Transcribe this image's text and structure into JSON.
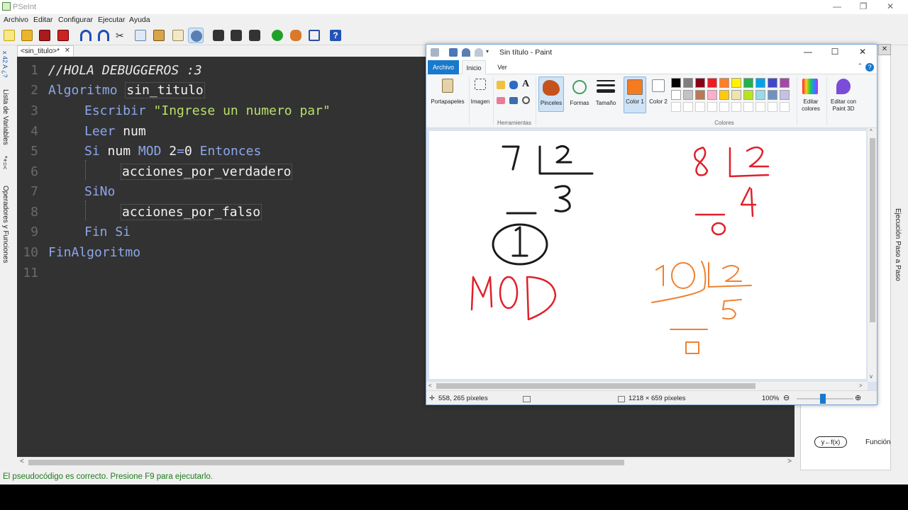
{
  "pseint": {
    "window_title": "PSeInt",
    "menu": [
      "Archivo",
      "Editar",
      "Configurar",
      "Ejecutar",
      "Ayuda"
    ],
    "left_panel_labels": [
      "Lista de Variables",
      "Operadores y Funciones"
    ],
    "editor_tab": "<sin_titulo>*",
    "tab_close": "✕",
    "code_lines": [
      {
        "n": "1",
        "text": "//HOLA DEBUGGEROS :3"
      },
      {
        "n": "2",
        "kw1": "Algoritmo",
        "id": "sin_titulo"
      },
      {
        "n": "3",
        "kw1": "Escribir",
        "str": "\"Ingrese un numero par\""
      },
      {
        "n": "4",
        "kw1": "Leer",
        "id": "num"
      },
      {
        "n": "5",
        "kw1": "Si",
        "id": "num",
        "kw2": "MOD",
        "num": "2",
        "op": "=",
        "num2": "0",
        "kw3": "Entonces"
      },
      {
        "n": "6",
        "id": "acciones_por_verdadero"
      },
      {
        "n": "7",
        "kw1": "SiNo"
      },
      {
        "n": "8",
        "id": "acciones_por_falso"
      },
      {
        "n": "9",
        "kw1": "Fin Si"
      },
      {
        "n": "10",
        "kw1": "FinAlgoritmo"
      },
      {
        "n": "11"
      }
    ],
    "right_panel": {
      "function_key": "y←f(x)",
      "function_label": "Función",
      "vertical_label": "Ejecución Paso a Paso"
    },
    "status": "El pseudocódigo es correcto. Presione F9 para ejecutarlo."
  },
  "paint": {
    "window_title": "Sin título - Paint",
    "tabs": [
      "Archivo",
      "Inicio",
      "Ver"
    ],
    "ribbon": {
      "portapapeles": "Portapapeles",
      "imagen": "Imagen",
      "herramientas": "Herramientas",
      "pinceles": "Pinceles",
      "formas": "Formas",
      "tamano": "Tamaño",
      "color1": "Color 1",
      "color2": "Color 2",
      "colores": "Colores",
      "editar_colores": "Editar colores",
      "editar_paint3d": "Editar con Paint 3D",
      "color1_value": "#f47b20",
      "palette": [
        "#000000",
        "#7f7f7f",
        "#880015",
        "#ed1c24",
        "#ff7f27",
        "#fff200",
        "#22b14c",
        "#00a2e8",
        "#3f48cc",
        "#a349a4",
        "#ffffff",
        "#c3c3c3",
        "#b97a57",
        "#ffaec9",
        "#ffc90e",
        "#efe4b0",
        "#b5e61d",
        "#99d9ea",
        "#7092be",
        "#c8bfe7"
      ]
    },
    "status": {
      "cursor_pos": "558, 265 píxeles",
      "canvas_size": "1218 × 659 píxeles",
      "zoom": "100%"
    },
    "drawing": {
      "ink_black": "#1a1a1a",
      "ink_red": "#e0202a",
      "ink_orange": "#f08030"
    }
  }
}
